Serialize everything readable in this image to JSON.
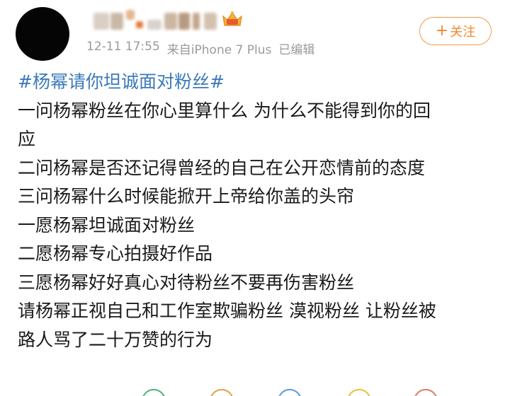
{
  "post": {
    "timestamp": "12-11 17:55",
    "source": "来自iPhone 7 Plus",
    "edited": "已编辑",
    "follow_label": "关注",
    "follow_plus": "+",
    "hashtag": "#杨幂请你坦诚面对粉丝#",
    "lines": [
      "一问杨幂粉丝在你心里算什么 为什么不能得到你的回",
      "应",
      "二问杨幂是否还记得曾经的自己在公开恋情前的态度",
      "三问杨幂什么时候能掀开上帝给你盖的头帘",
      "一愿杨幂坦诚面对粉丝",
      "二愿杨幂专心拍摄好作品",
      "三愿杨幂好好真心对待粉丝不要再伤害粉丝",
      "请杨幂正视自己和工作室欺骗粉丝 漠视粉丝 让粉丝被",
      "路人骂了二十万赞的行为"
    ]
  },
  "icons": {
    "avatar": "avatar",
    "crown": "vip-crown-icon",
    "action_icons": [
      "share-icon",
      "comment-icon",
      "like-icon",
      "reward-icon",
      "more-icon"
    ]
  },
  "colors": {
    "accent": "#f08a2c",
    "hashtag": "#3b79b8",
    "meta_text": "#9a9a9a",
    "body_text": "#1a1a1a"
  }
}
